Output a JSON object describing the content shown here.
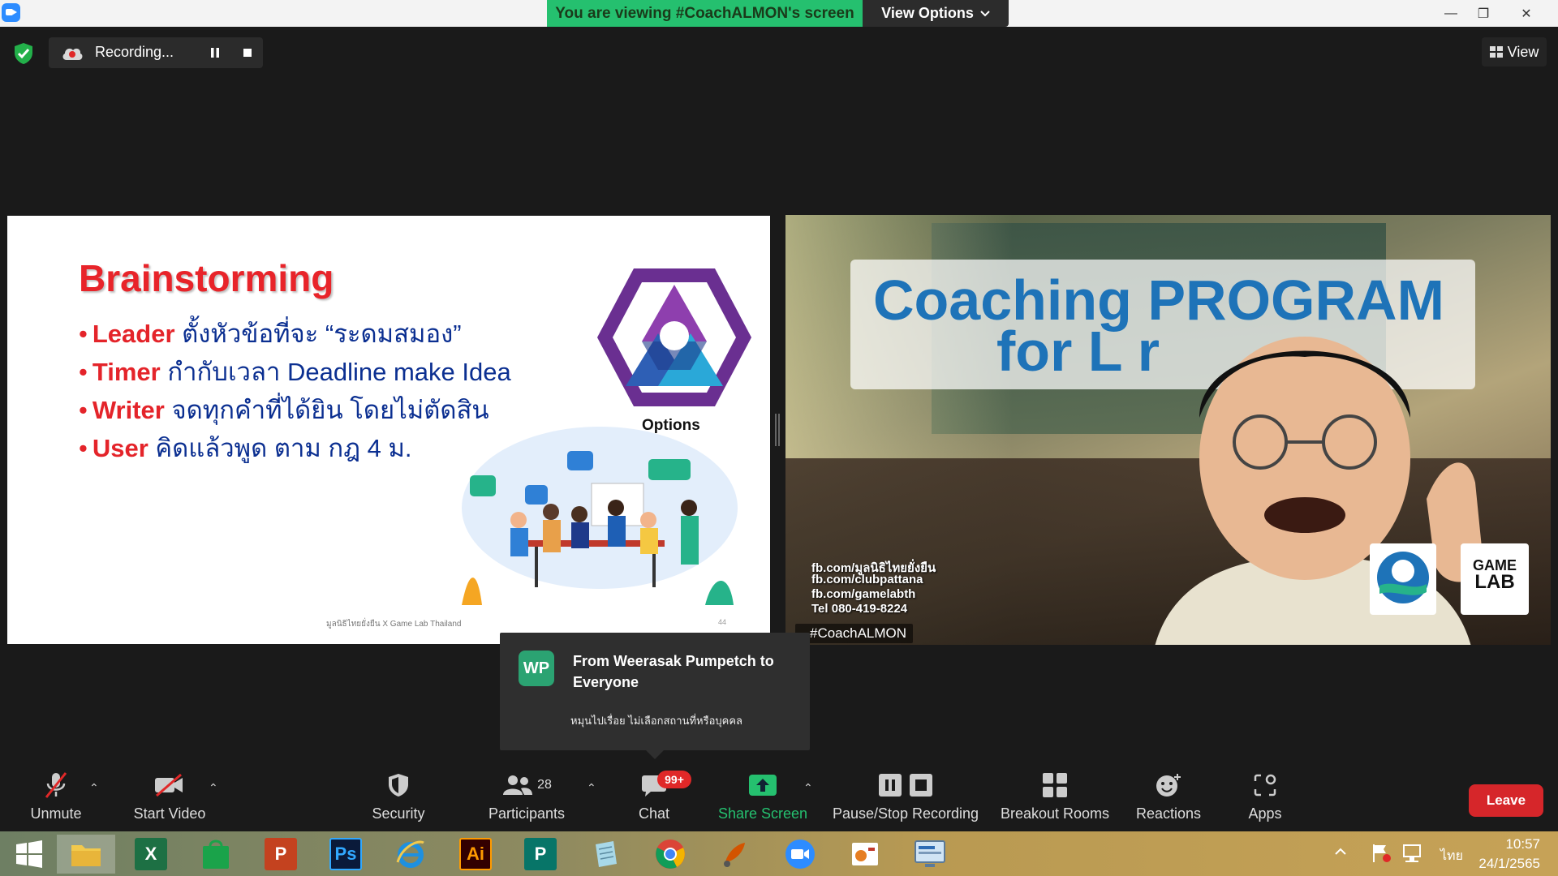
{
  "titlebar": {
    "banner": "You are viewing #CoachALMON's screen",
    "view_options": "View Options",
    "minimize": "—",
    "restore": "❐",
    "close": "✕"
  },
  "recording": {
    "label": "Recording..."
  },
  "view_button": "View",
  "slide": {
    "title": "Brainstorming",
    "bullets": [
      {
        "keyword": "Leader",
        "text": " ตั้งหัวข้อที่จะ “ระดมสมอง”"
      },
      {
        "keyword": "Timer",
        "text": " กำกับเวลา Deadline make Idea"
      },
      {
        "keyword": "Writer",
        "text": " จดทุกคำที่ได้ยิน โดยไม่ตัดสิน"
      },
      {
        "keyword": "User",
        "text": " คิดแล้วพูด ตาม กฎ 4 ม."
      }
    ],
    "options_caption": "Options",
    "footer": "มูลนิธิไทยยั่งยืน X Game Lab Thailand",
    "page_number": "44"
  },
  "video": {
    "title_line1": "Coaching PROGRAM",
    "title_line2": "for L        r",
    "contacts": [
      "fb.com/มูลนิธิไทยยั่งยืน",
      "fb.com/clubpattana",
      "fb.com/gamelabth",
      "Tel 080-419-8224"
    ],
    "logo_text_line1": "GAME",
    "logo_text_line2": "LAB",
    "participant_name": "#CoachALMON"
  },
  "toast": {
    "avatar_initials": "WP",
    "title": "From Weerasak Pumpetch to Everyone",
    "message": "หมุนไปเรื่อย ไม่เลือกสถานที่หรือบุคคล"
  },
  "toolbar": {
    "unmute": "Unmute",
    "start_video": "Start Video",
    "security": "Security",
    "participants": "Participants",
    "participants_count": "28",
    "chat": "Chat",
    "chat_badge": "99+",
    "share_screen": "Share Screen",
    "pause_stop_recording": "Pause/Stop Recording",
    "breakout_rooms": "Breakout Rooms",
    "reactions": "Reactions",
    "apps": "Apps",
    "leave": "Leave"
  },
  "taskbar": {
    "apps": [
      "windows-start",
      "file-explorer",
      "excel",
      "store",
      "powerpoint",
      "photoshop",
      "internet-explorer",
      "illustrator",
      "publisher",
      "notepad",
      "chrome",
      "paint",
      "zoom",
      "slideshow",
      "remote-desktop"
    ],
    "excel_label": "X",
    "powerpoint_label": "P",
    "photoshop_label": "Ps",
    "illustrator_label": "Ai",
    "publisher_label": "P",
    "language": "ไทย",
    "time": "10:57",
    "date": "24/1/2565"
  },
  "colors": {
    "banner_green": "#25c06f",
    "slide_red": "#e4242a",
    "slide_blue": "#0b2f91",
    "leave_red": "#d6262a",
    "share_green": "#25c06f",
    "video_title_blue": "#1e73b8"
  }
}
